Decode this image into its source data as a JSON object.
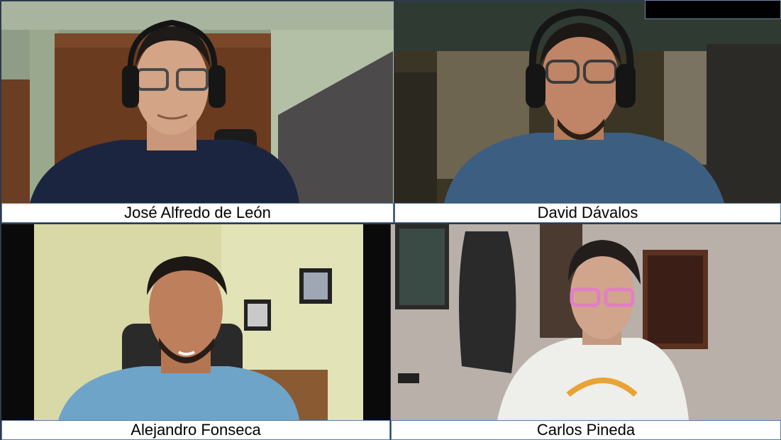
{
  "participants": [
    {
      "name": "José Alfredo de León"
    },
    {
      "name": "David Dávalos"
    },
    {
      "name": "Alejandro Fonseca"
    },
    {
      "name": "Carlos Pineda"
    }
  ]
}
